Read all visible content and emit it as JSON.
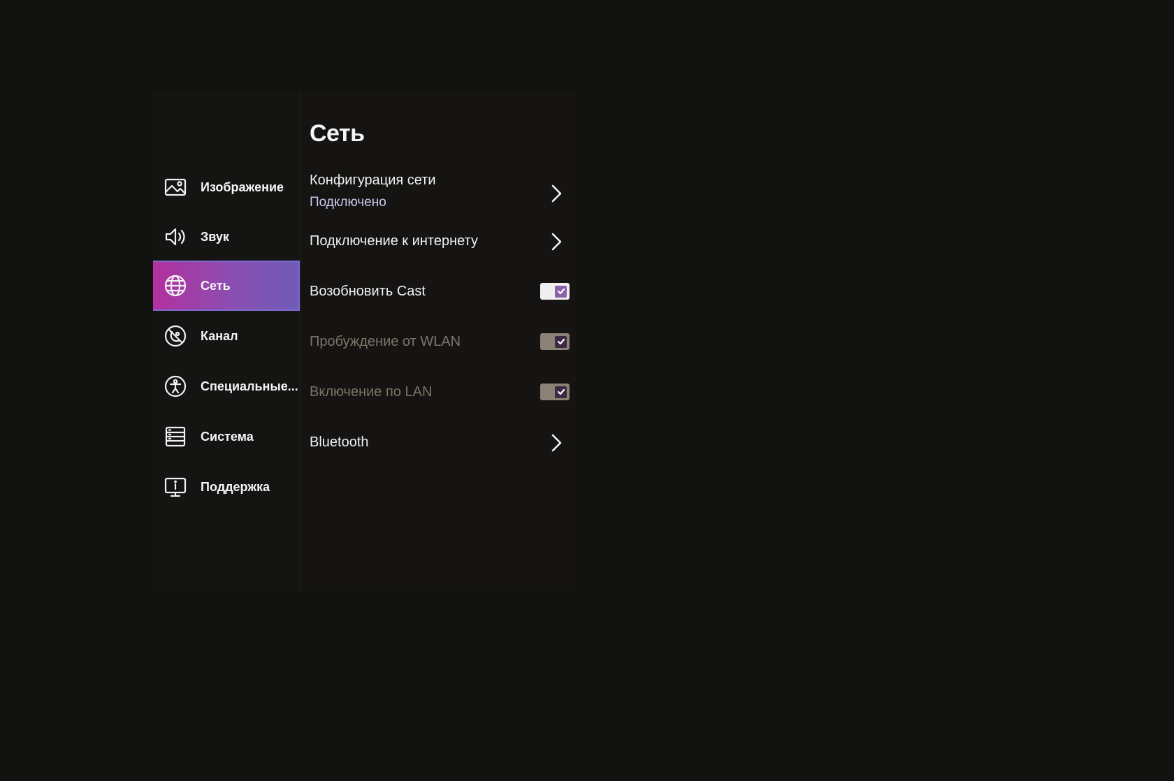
{
  "sidebar": {
    "items": [
      {
        "label": "Изображение",
        "icon": "image-icon"
      },
      {
        "label": "Звук",
        "icon": "speaker-icon"
      },
      {
        "label": "Сеть",
        "icon": "globe-icon",
        "active": true
      },
      {
        "label": "Канал",
        "icon": "antenna-icon"
      },
      {
        "label": "Специальные...",
        "icon": "accessibility-icon"
      },
      {
        "label": "Система",
        "icon": "system-list-icon"
      },
      {
        "label": "Поддержка",
        "icon": "support-monitor-icon"
      }
    ]
  },
  "main": {
    "title": "Сеть",
    "rows": [
      {
        "label": "Конфигурация сети",
        "sublabel": "Подключено",
        "control": "chevron"
      },
      {
        "label": "Подключение к интернету",
        "control": "chevron"
      },
      {
        "label": "Возобновить Cast",
        "control": "toggle",
        "checked": true,
        "enabled": true
      },
      {
        "label": "Пробуждение от WLAN",
        "control": "toggle",
        "checked": true,
        "enabled": false
      },
      {
        "label": "Включение по LAN",
        "control": "toggle",
        "checked": true,
        "enabled": false
      },
      {
        "label": "Bluetooth",
        "control": "chevron"
      }
    ]
  },
  "colors": {
    "background": "#121310",
    "active_gradient_start": "#b3309e",
    "active_gradient_end": "#6f5bb6",
    "sublabel": "#c9c9ee",
    "disabled_text": "#7e7468"
  }
}
